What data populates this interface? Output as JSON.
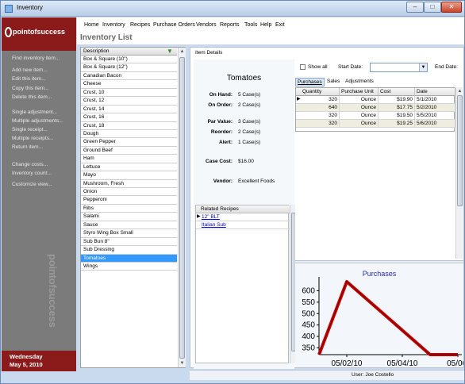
{
  "window": {
    "title": "Inventory",
    "caption_buttons": [
      "minimize",
      "maximize",
      "close"
    ]
  },
  "brand": {
    "logo_text": "pointofsuccess",
    "watermark_text": "pointofsuccess"
  },
  "sidebar": {
    "links": [
      "Find inventory item...",
      "Add new item...",
      "Edit this item...",
      "Copy this item...",
      "Delete this item...",
      "Single adjustment...",
      "Multiple adjustments...",
      "Single receipt...",
      "Multiple receipts...",
      "Return item...",
      "Change costs...",
      "Inventory count...",
      "Customize view..."
    ],
    "date_line1": "Wednesday",
    "date_line2": "May 5, 2010"
  },
  "menu": [
    "Home",
    "Inventory",
    "Recipes",
    "Purchase Orders",
    "Vendors",
    "Reports",
    "Tools",
    "Help",
    "Exit"
  ],
  "page_title": "Inventory List",
  "list": {
    "header": "Description",
    "selected_index": 26,
    "items": [
      "Box & Square (10\")",
      "Box & Square (12\")",
      "Canadian Bacon",
      "Cheese",
      "Crust, 10",
      "Crust, 12",
      "Crust, 14",
      "Crust, 16",
      "Crust, 18",
      "Dough",
      "Green Pepper",
      "Ground Beef",
      "Ham",
      "Lettuce",
      "Mayo",
      "Mushroom, Fresh",
      "Onion",
      "Pepperoni",
      "Ribs",
      "Salami",
      "Sauce",
      "Styro Wing Box Small",
      "Sub Bun 8\"",
      "Sub Dressing",
      "Tomatoes",
      "Wings"
    ]
  },
  "details": {
    "tab_label": "Item Details",
    "item_name": "Tomatoes",
    "fields": [
      {
        "label": "On Hand:",
        "value": "5 Case(s)"
      },
      {
        "label": "On Order:",
        "value": "2 Case(s)"
      },
      {
        "label": "Par Value:",
        "value": "3 Case(s)"
      },
      {
        "label": "Reorder:",
        "value": "2 Case(s)"
      },
      {
        "label": "Alert:",
        "value": "1 Case(s)"
      },
      {
        "label": "Case Cost:",
        "value": "$16.00"
      },
      {
        "label": "Vendor:",
        "value": "Excellent Foods"
      }
    ],
    "related_header": "Related Recipes",
    "related_recipes": [
      "12\" BLT",
      "Italian Sub"
    ]
  },
  "filters": {
    "show_all_label": "Show all",
    "show_all_checked": false,
    "start_date_label": "Start Date:",
    "start_date_value": "",
    "end_date_label": "End Date:"
  },
  "subtabs": [
    "Purchases",
    "Sales",
    "Adjustments"
  ],
  "purchases_grid": {
    "columns": [
      "Quantity",
      "Purchase Unit",
      "Cost",
      "Date"
    ],
    "rows": [
      {
        "quantity": "320",
        "unit": "Ounce",
        "cost": "$19.90",
        "date": "5/1/2010"
      },
      {
        "quantity": "640",
        "unit": "Ounce",
        "cost": "$17.75",
        "date": "5/2/2010"
      },
      {
        "quantity": "320",
        "unit": "Ounce",
        "cost": "$19.50",
        "date": "5/5/2010"
      },
      {
        "quantity": "320",
        "unit": "Ounce",
        "cost": "$19.25",
        "date": "5/6/2010"
      }
    ]
  },
  "chart_data": {
    "type": "line",
    "title": "Purchases",
    "x": [
      "05/01/10",
      "05/02/10",
      "05/05/10",
      "05/06/10"
    ],
    "values": [
      320,
      640,
      320,
      320
    ],
    "x_tick_labels": [
      "05/02/10",
      "05/04/10",
      "05/06/"
    ],
    "y_tick_labels": [
      "600",
      "550",
      "500",
      "450",
      "400",
      "350"
    ],
    "ylim": [
      320,
      640
    ],
    "grid": false,
    "series_color": "#cc0000"
  },
  "status": {
    "user": "User: Joe Costello"
  },
  "colors": {
    "brand_red": "#8b1a1a",
    "sidebar_gray": "#7b7b7b",
    "selection": "#3399ff",
    "chart_title": "#2a2ab0"
  }
}
